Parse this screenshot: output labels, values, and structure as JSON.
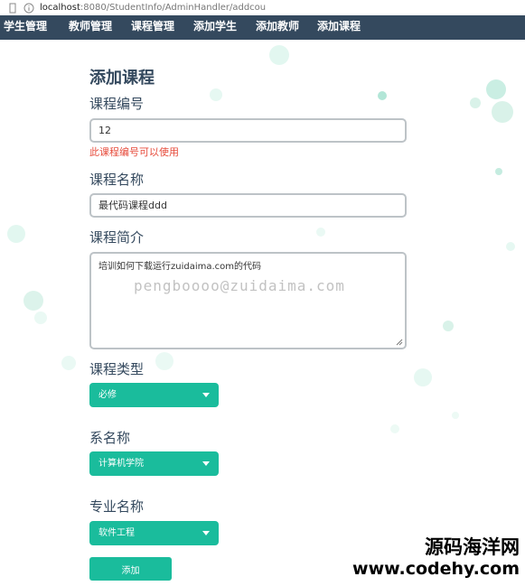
{
  "browser": {
    "url_host": "localhost",
    "url_rest": ":8080/StudentInfo/AdminHandler/addcou"
  },
  "nav": {
    "items": [
      "学生管理",
      "教师管理",
      "课程管理",
      "添加学生",
      "添加教师",
      "添加课程"
    ]
  },
  "form": {
    "title": "添加课程",
    "course_id": {
      "label": "课程编号",
      "value": "12",
      "hint": "此课程编号可以使用"
    },
    "course_name": {
      "label": "课程名称",
      "value": "最代码课程ddd"
    },
    "course_desc": {
      "label": "课程简介",
      "value": "培训如何下载运行zuidaima.com的代码",
      "watermark": "pengboooo@zuidaima.com"
    },
    "course_type": {
      "label": "课程类型",
      "selected": "必修"
    },
    "department": {
      "label": "系名称",
      "selected": "计算机学院"
    },
    "major": {
      "label": "专业名称",
      "selected": "软件工程"
    },
    "submit_label": "添加"
  },
  "brand": {
    "line1": "源码海洋网",
    "line2": "www.codehy.com"
  },
  "colors": {
    "nav_bg": "#34495e",
    "accent": "#1abc9c",
    "hint": "#e74c3c",
    "text": "#34495e"
  }
}
